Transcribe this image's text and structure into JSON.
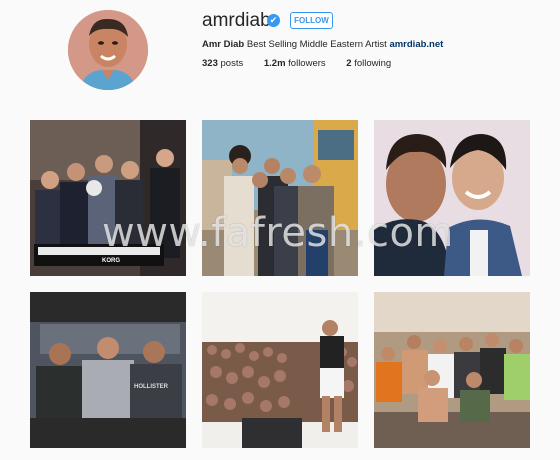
{
  "profile": {
    "username": "amrdiab",
    "verified_icon": "check",
    "follow_label": "FOLLOW",
    "display_name": "Amr Diab",
    "bio_text": "Best Selling Middle Eastern Artist",
    "website": "amrdiab.net",
    "avatar_icon": "profile-photo"
  },
  "stats": {
    "posts_count": "323",
    "posts_label": "posts",
    "followers_count": "1.2m",
    "followers_label": "followers",
    "following_count": "2",
    "following_label": "following"
  },
  "posts": [
    {
      "id": "post-1",
      "kbd_text": "KORG"
    },
    {
      "id": "post-2"
    },
    {
      "id": "post-3"
    },
    {
      "id": "post-4",
      "shirt_text": "HOLLISTER"
    },
    {
      "id": "post-5"
    },
    {
      "id": "post-6"
    }
  ],
  "watermark": "www.fafresh.com",
  "colors": {
    "accent": "#3897f0",
    "link": "#003569",
    "background": "#fafafa"
  }
}
